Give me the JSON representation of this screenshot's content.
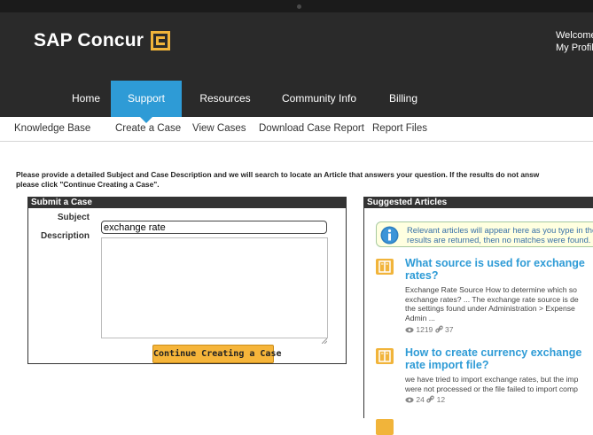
{
  "header": {
    "brand": "SAP Concur",
    "welcome_line1": "Welcome",
    "welcome_line2": "My Profile"
  },
  "nav": {
    "tabs": [
      {
        "label": "Home"
      },
      {
        "label": "Support",
        "active": true
      },
      {
        "label": "Resources"
      },
      {
        "label": "Community Info"
      },
      {
        "label": "Billing"
      }
    ]
  },
  "subnav": {
    "items": [
      "Knowledge Base",
      "Create a Case",
      "View Cases",
      "Download Case Report",
      "Report Files"
    ]
  },
  "instructions": {
    "line1": "Please provide a detailed Subject and Case Description and we will search to locate an Article that answers your question. If the results do not answ",
    "line2": "please click \"Continue Creating a Case\"."
  },
  "submit_case": {
    "title": "Submit a Case",
    "subject_label": "Subject",
    "subject_value": "exchange rate",
    "description_label": "Description",
    "description_value": "",
    "continue_label": "Continue Creating a Case"
  },
  "suggested": {
    "title": "Suggested Articles",
    "info_line1": "Relevant articles will appear here as you type in the",
    "info_line2": "results are returned, then no matches were found.",
    "articles": [
      {
        "title": "What source is used for exchange rates?",
        "desc": [
          "Exchange Rate Source How to determine which so",
          "exchange rates? ... The exchange rate source is de",
          "the settings found under Administration > Expense",
          "Admin ..."
        ],
        "views": "1219",
        "links": "37"
      },
      {
        "title": "How to create currency exchange rate import file?",
        "desc": [
          "we have tried to import exchange rates, but the imp",
          "were not processed or the file failed to import comp"
        ],
        "views": "24",
        "links": "12"
      }
    ]
  },
  "colors": {
    "header_bg": "#2a2a2a",
    "active_tab": "#2e9bd6",
    "brand_accent": "#f1b43a",
    "button": "#f6b53a",
    "article_link": "#2e9bd6"
  }
}
